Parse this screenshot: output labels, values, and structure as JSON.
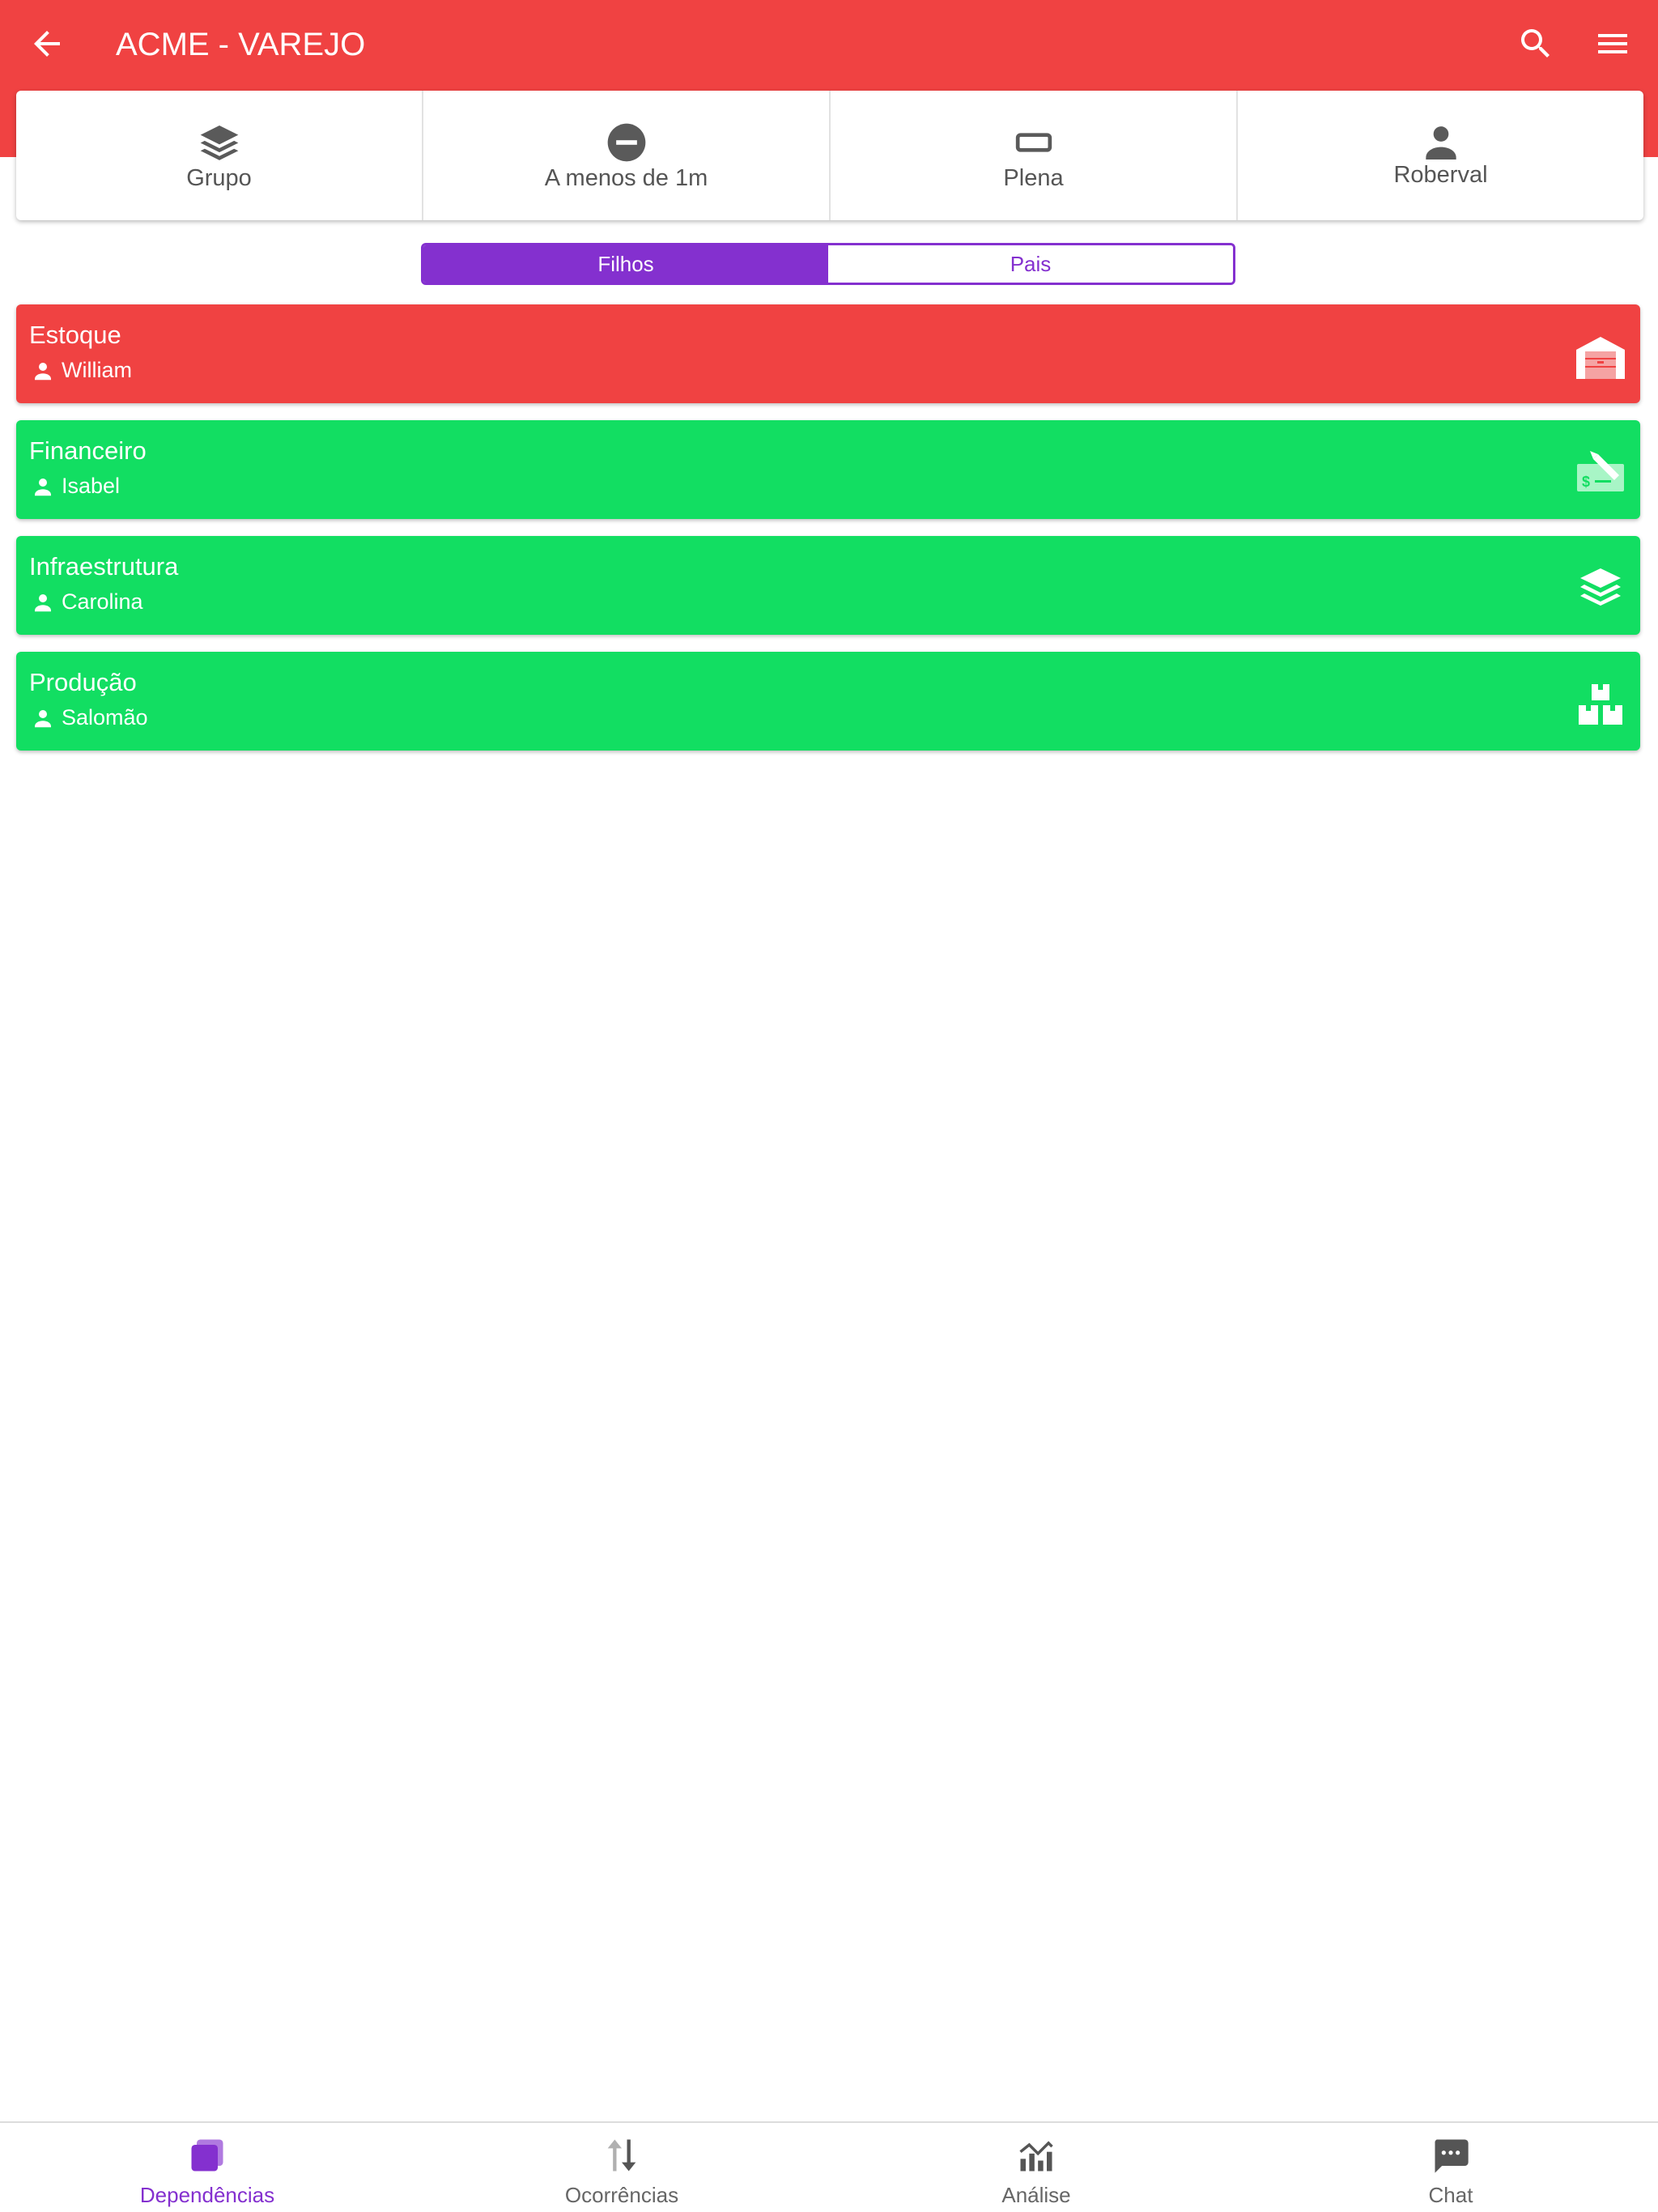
{
  "app": {
    "title": "ACME - VAREJO"
  },
  "colors": {
    "header": "#f04242",
    "accent": "#8430cf",
    "alert": "#f04242",
    "ok": "#12de62"
  },
  "icons": {
    "back": "arrow-left-icon",
    "search": "search-icon",
    "menu": "hamburger-menu-icon"
  },
  "info": [
    {
      "label": "Grupo",
      "icon": "layers-icon"
    },
    {
      "label": "A menos de 1m",
      "icon": "minus-circle-icon"
    },
    {
      "label": "Plena",
      "icon": "rectangle-outline-icon"
    },
    {
      "label": "Roberval",
      "icon": "person-icon"
    }
  ],
  "segment": {
    "active": "Filhos",
    "inactive": "Pais"
  },
  "dependencies": [
    {
      "name": "Estoque",
      "owner": "William",
      "status": "alert",
      "icon": "warehouse-icon"
    },
    {
      "name": "Financeiro",
      "owner": "Isabel",
      "status": "ok",
      "icon": "money-check-edit-icon"
    },
    {
      "name": "Infraestrutura",
      "owner": "Carolina",
      "status": "ok",
      "icon": "layers-icon"
    },
    {
      "name": "Produção",
      "owner": "Salomão",
      "status": "ok",
      "icon": "boxes-icon"
    }
  ],
  "nav": [
    {
      "label": "Dependências",
      "icon": "dependencies-icon",
      "active": true
    },
    {
      "label": "Ocorrências",
      "icon": "sort-arrows-icon",
      "active": false
    },
    {
      "label": "Análise",
      "icon": "chart-icon",
      "active": false
    },
    {
      "label": "Chat",
      "icon": "chat-icon",
      "active": false
    }
  ]
}
